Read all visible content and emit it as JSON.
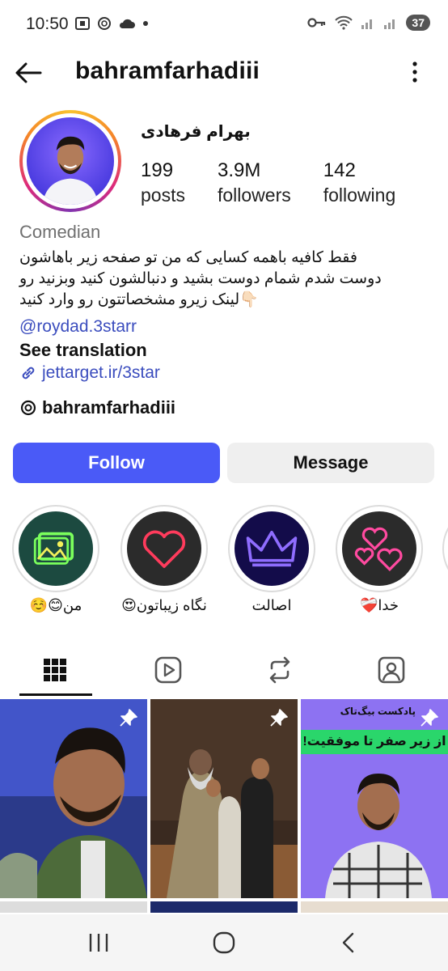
{
  "status_bar": {
    "time": "10:50",
    "battery": "37",
    "left_icons": [
      "screenshot-icon",
      "threads-icon",
      "cloud-icon",
      "dot-icon"
    ],
    "right_icons": [
      "key-icon",
      "wifi-icon",
      "signal-icon",
      "signal-icon"
    ]
  },
  "header": {
    "username": "bahramfarhadiii",
    "back_icon": "back-arrow-icon",
    "more_icon": "more-vertical-icon"
  },
  "profile": {
    "full_name": "بهرام فرهادی",
    "stats": [
      {
        "value": "199",
        "label": "posts"
      },
      {
        "value": "3.9M",
        "label": "followers"
      },
      {
        "value": "142",
        "label": "following"
      }
    ],
    "category": "Comedian",
    "bio_lines": [
      "فقط کافیه باهمه کسایی که من تو صفحه زیر باهاشون",
      "دوست شدم شمام دوست بشید و دنبالشون کنید وبزنید رو",
      "👇🏻لینک زیرو مشخصاتتون رو وارد کنید"
    ],
    "mention": "@roydad.3starr",
    "see_translation": "See translation",
    "link": "jettarget.ir/3star",
    "threads_handle": "bahramfarhadiii"
  },
  "buttons": {
    "follow": "Follow",
    "message": "Message"
  },
  "highlights": [
    {
      "label": "من😊☺️",
      "icon": "neon-photo-icon"
    },
    {
      "label": "نگاه زیباتون😍",
      "icon": "neon-heart-icon"
    },
    {
      "label": "اصالت",
      "icon": "neon-crown-icon"
    },
    {
      "label": "خدا❤️‍🩹",
      "icon": "neon-hearts-icon"
    }
  ],
  "tabs": [
    "grid-icon",
    "reels-icon",
    "reposts-icon",
    "tagged-icon"
  ],
  "posts": [
    {
      "pinned": true,
      "overlay_text": ""
    },
    {
      "pinned": true,
      "overlay_text": ""
    },
    {
      "pinned": true,
      "overlay_text_top": "پادکست بیگ‌تاک",
      "overlay_text_banner": "از زیر صفر تا موفقیت!"
    }
  ],
  "nav_bar": [
    "recents-button",
    "home-button",
    "back-button"
  ],
  "colors": {
    "follow_button": "#4a5af7",
    "message_button": "#efefef",
    "link": "#3b4dbe",
    "category": "#707070"
  }
}
